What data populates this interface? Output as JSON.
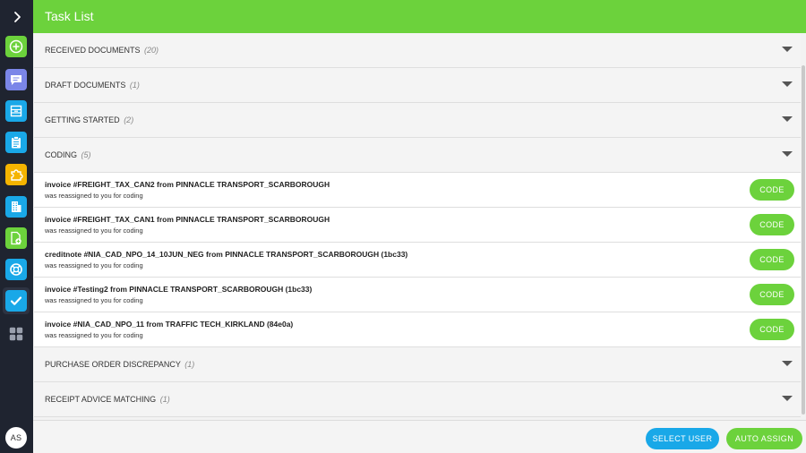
{
  "header": {
    "title": "Task List"
  },
  "sidebar": {
    "avatar_initials": "AS",
    "colors": {
      "add": "#6cd23c",
      "messages": "#7b86e8",
      "inbox": "#19a8e8",
      "clipboard": "#19a8e8",
      "puzzle": "#f5b400",
      "building": "#19a8e8",
      "doc_add": "#6cd23c",
      "lifebuoy": "#19a8e8",
      "tasks": "#19a8e8",
      "apps": "#9aa0ad"
    }
  },
  "sections_top": [
    {
      "label": "RECEIVED DOCUMENTS",
      "count": "(20)"
    },
    {
      "label": "DRAFT DOCUMENTS",
      "count": "(1)"
    },
    {
      "label": "GETTING STARTED",
      "count": "(2)"
    },
    {
      "label": "CODING",
      "count": "(5)"
    }
  ],
  "coding_items": [
    {
      "title": "invoice #FREIGHT_TAX_CAN2 from PINNACLE TRANSPORT_SCARBOROUGH",
      "subtitle": "was reassigned to you for coding",
      "action": "CODE"
    },
    {
      "title": "invoice #FREIGHT_TAX_CAN1 from PINNACLE TRANSPORT_SCARBOROUGH",
      "subtitle": "was reassigned to you for coding",
      "action": "CODE"
    },
    {
      "title": "creditnote #NIA_CAD_NPO_14_10JUN_NEG from PINNACLE TRANSPORT_SCARBOROUGH (1bc33)",
      "subtitle": "was reassigned to you for coding",
      "action": "CODE"
    },
    {
      "title": "invoice #Testing2 from PINNACLE TRANSPORT_SCARBOROUGH (1bc33)",
      "subtitle": "was reassigned to you for coding",
      "action": "CODE"
    },
    {
      "title": "invoice #NIA_CAD_NPO_11 from TRAFFIC TECH_KIRKLAND (84e0a)",
      "subtitle": "was reassigned to you for coding",
      "action": "CODE"
    }
  ],
  "sections_bottom": [
    {
      "label": "PURCHASE ORDER DISCREPANCY",
      "count": "(1)"
    },
    {
      "label": "RECEIPT ADVICE MATCHING",
      "count": "(1)"
    }
  ],
  "footer": {
    "select_user_label": "SELECT USER",
    "auto_assign_label": "AUTO ASSIGN"
  },
  "colors": {
    "brand_green": "#6cd23c",
    "accent_blue": "#19a8e8",
    "sidebar_bg": "#1f2430"
  }
}
